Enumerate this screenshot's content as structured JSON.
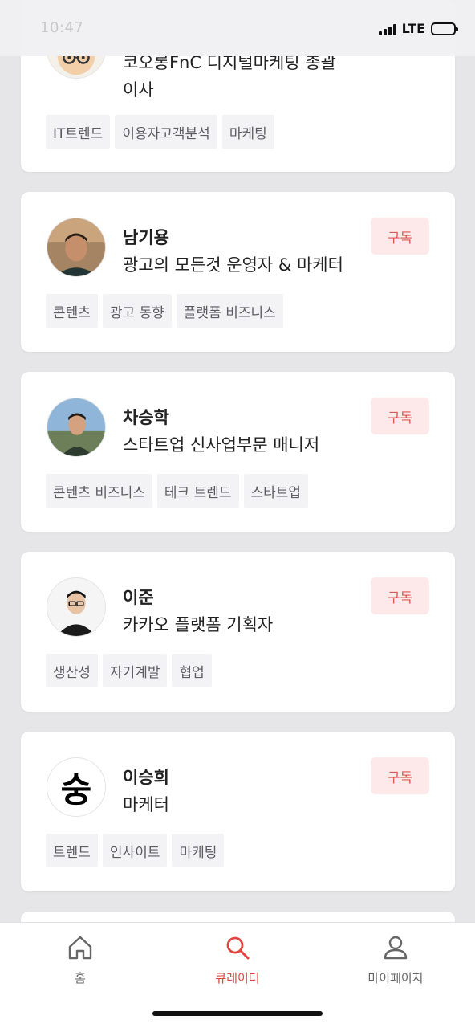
{
  "status": {
    "time": "10:47",
    "network": "LTE"
  },
  "subscribe_label": "구독",
  "cards": [
    {
      "name": "",
      "title_line1": "코오롱FnC 디지털마케팅 총괄",
      "title_line2": "이사",
      "tags": [
        "IT트렌드",
        "이용자고객분석",
        "마케팅"
      ]
    },
    {
      "name": "남기용",
      "title": "광고의 모든것 운영자 & 마케터",
      "tags": [
        "콘텐츠",
        "광고 동향",
        "플랫폼 비즈니스"
      ]
    },
    {
      "name": "차승학",
      "title": "스타트업 신사업부문 매니저",
      "tags": [
        "콘텐츠 비즈니스",
        "테크 트렌드",
        "스타트업"
      ]
    },
    {
      "name": "이준",
      "title": "카카오 플랫폼 기획자",
      "tags": [
        "생산성",
        "자기계발",
        "협업"
      ]
    },
    {
      "name": "이승희",
      "title": "마케터",
      "avatar_glyph": "숭",
      "tags": [
        "트렌드",
        "인사이트",
        "마케팅"
      ]
    }
  ],
  "nav": {
    "home": {
      "label": "홈",
      "icon": "home-icon"
    },
    "curator": {
      "label": "큐레이터",
      "icon": "search-icon"
    },
    "mypage": {
      "label": "마이페이지",
      "icon": "person-icon"
    },
    "active": "curator",
    "active_color": "#e0453f"
  },
  "colors": {
    "subscribe_bg": "#fde9e9",
    "subscribe_text": "#e05a55",
    "tag_bg": "#f3f3f5"
  }
}
